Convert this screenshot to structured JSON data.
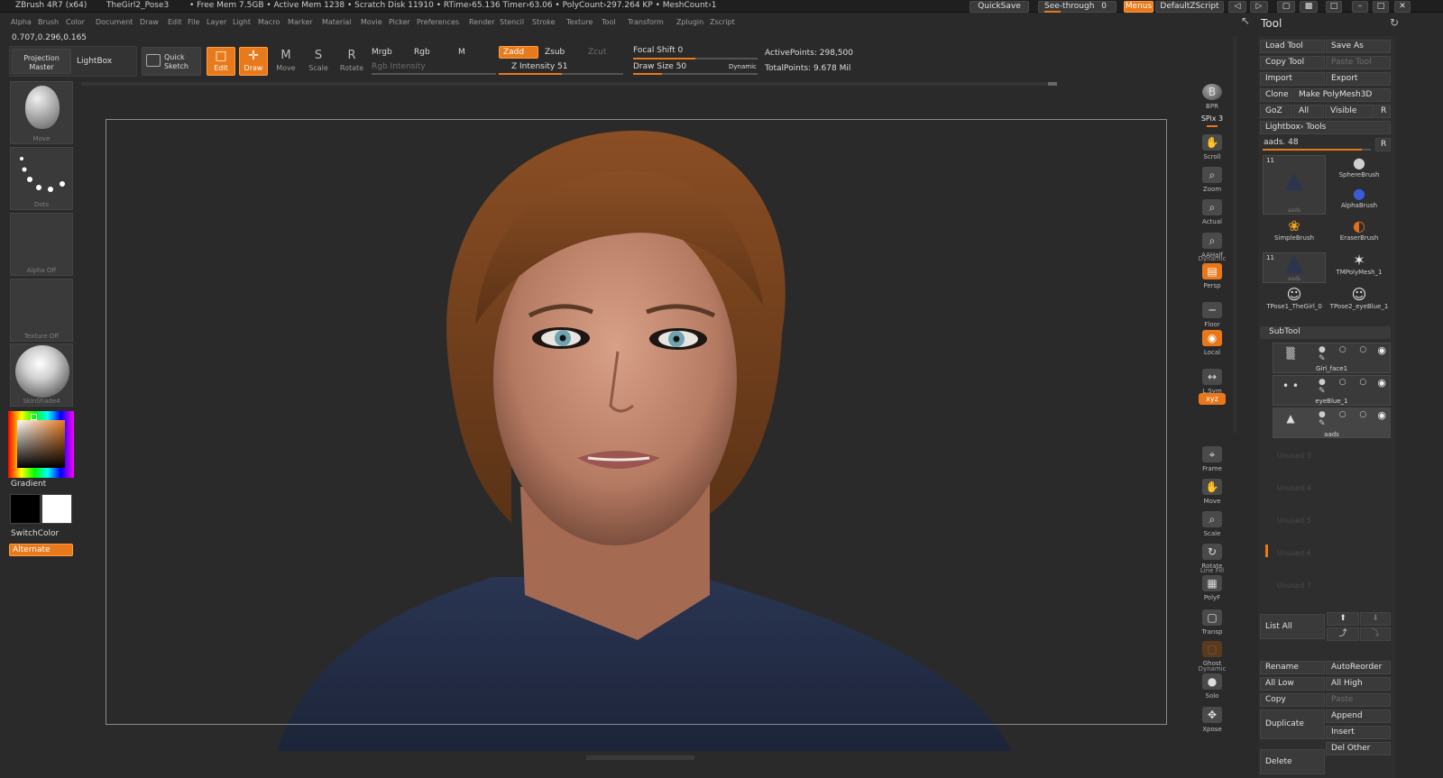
{
  "titlebar": {
    "app": "ZBrush 4R7 (x64)",
    "document": "TheGirl2_Pose3",
    "stats": "• Free Mem 7.5GB • Active Mem 1238 • Scratch Disk 11910 • RTime›65.136 Timer›63.06 • PolyCount›297.264 KP • MeshCount›1",
    "quicksave": "QuickSave",
    "see_through": "See-through",
    "see_through_value": "0",
    "menus": "Menus",
    "script": "DefaultZScript"
  },
  "menubar": [
    "Alpha",
    "Brush",
    "Color",
    "Document",
    "Draw",
    "Edit",
    "File",
    "Layer",
    "Light",
    "Macro",
    "Marker",
    "Material",
    "Movie",
    "Picker",
    "Preferences",
    "Render",
    "Stencil",
    "Stroke",
    "Texture",
    "Tool",
    "Transform",
    "Zplugin",
    "Zscript"
  ],
  "coords": "0.707,0.296,0.165",
  "toolbar": {
    "projection_master": "Projection Master",
    "lightbox": "LightBox",
    "quick_sketch": "Quick Sketch",
    "edit": "Edit",
    "draw": "Draw",
    "move": "Move",
    "scale": "Scale",
    "rotate": "Rotate",
    "mrgb": "Mrgb",
    "rgb": "Rgb",
    "m": "M",
    "rgb_intensity": "Rgb Intensity",
    "zadd": "Zadd",
    "zsub": "Zsub",
    "zcut": "Zcut",
    "z_intensity": "Z Intensity 51",
    "focal_shift": "Focal Shift 0",
    "draw_size": "Draw Size 50",
    "dynamic": "Dynamic",
    "active_points": "ActivePoints: 298,500",
    "total_points": "TotalPoints: 9.678 Mil"
  },
  "left_shelf": {
    "brush": "Move",
    "stroke": "Dots",
    "alpha": "Alpha Off",
    "texture": "Texture Off",
    "material": "SkinShade4",
    "gradient": "Gradient",
    "switch_color": "SwitchColor",
    "alternate": "Alternate"
  },
  "right_shelf": [
    {
      "name": "bpr",
      "label": "BPR",
      "icon": "B"
    },
    {
      "name": "spix",
      "label": "SPix 3",
      "icon": ""
    },
    {
      "name": "scroll",
      "label": "Scroll",
      "icon": "✋"
    },
    {
      "name": "zoom",
      "label": "Zoom",
      "icon": "⌕"
    },
    {
      "name": "actual",
      "label": "Actual",
      "icon": "⌕"
    },
    {
      "name": "aahalf",
      "label": "AAHalf",
      "icon": "⌕"
    },
    {
      "name": "persp",
      "label": "Persp",
      "icon": "▤",
      "top_label": "Dynamic"
    },
    {
      "name": "floor",
      "label": "Floor",
      "icon": "─"
    },
    {
      "name": "local",
      "label": "Local",
      "icon": "◉"
    },
    {
      "name": "lsym",
      "label": "L.Sym",
      "icon": "↔"
    },
    {
      "name": "xyz",
      "label": "xyz",
      "icon": ""
    },
    {
      "name": "frame",
      "label": "Frame",
      "icon": "⌖"
    },
    {
      "name": "move",
      "label": "Move",
      "icon": "✋"
    },
    {
      "name": "scale",
      "label": "Scale",
      "icon": "⌕"
    },
    {
      "name": "rotate",
      "label": "Rotate",
      "icon": "↻"
    },
    {
      "name": "polyf",
      "label": "PolyF",
      "icon": "▦",
      "top_label": "Line Fill"
    },
    {
      "name": "transp",
      "label": "Transp",
      "icon": "▢"
    },
    {
      "name": "ghost",
      "label": "Ghost",
      "icon": "▢"
    },
    {
      "name": "solo",
      "label": "Solo",
      "icon": "●",
      "top_label": "Dynamic"
    },
    {
      "name": "xpose",
      "label": "Xpose",
      "icon": "✥"
    }
  ],
  "tool_panel": {
    "title": "Tool",
    "load_tool": "Load Tool",
    "save_as": "Save As",
    "copy_tool": "Copy Tool",
    "paste_tool": "Paste Tool",
    "import": "Import",
    "export": "Export",
    "clone": "Clone",
    "make_polymesh": "Make PolyMesh3D",
    "goz": "GoZ",
    "all": "All",
    "visible": "Visible",
    "r": "R",
    "lightbox_tools": "Lightbox› Tools",
    "current_tool": "aads. 48",
    "thumbs": [
      {
        "name": "aads",
        "badge": "11"
      },
      {
        "name": "SphereBrush"
      },
      {
        "name": "AlphaBrush"
      },
      {
        "name": "SimpleBrush"
      },
      {
        "name": "EraserBrush"
      },
      {
        "name": "aads",
        "badge": "11"
      },
      {
        "name": "TMPolyMesh_1"
      },
      {
        "name": "TPose1_TheGirl_0"
      },
      {
        "name": "TPose2_eyeBlue_1"
      }
    ],
    "subtool_title": "SubTool",
    "subtools": [
      {
        "name": "Girl_face1"
      },
      {
        "name": "eyeBlue_1"
      },
      {
        "name": "aads"
      }
    ],
    "unused": [
      "Unused 3",
      "Unused 4",
      "Unused 5",
      "Unused 6",
      "Unused 7"
    ],
    "list_all": "List All",
    "rename": "Rename",
    "autoreorder": "AutoReorder",
    "all_low": "All Low",
    "all_high": "All High",
    "copy": "Copy",
    "paste": "Paste",
    "append": "Append",
    "duplicate": "Duplicate",
    "insert": "Insert",
    "delete": "Delete",
    "del_other": "Del Other"
  },
  "colors": {
    "accent": "#e9781a",
    "panel": "#333333",
    "viewport": "#2a2a2a"
  }
}
